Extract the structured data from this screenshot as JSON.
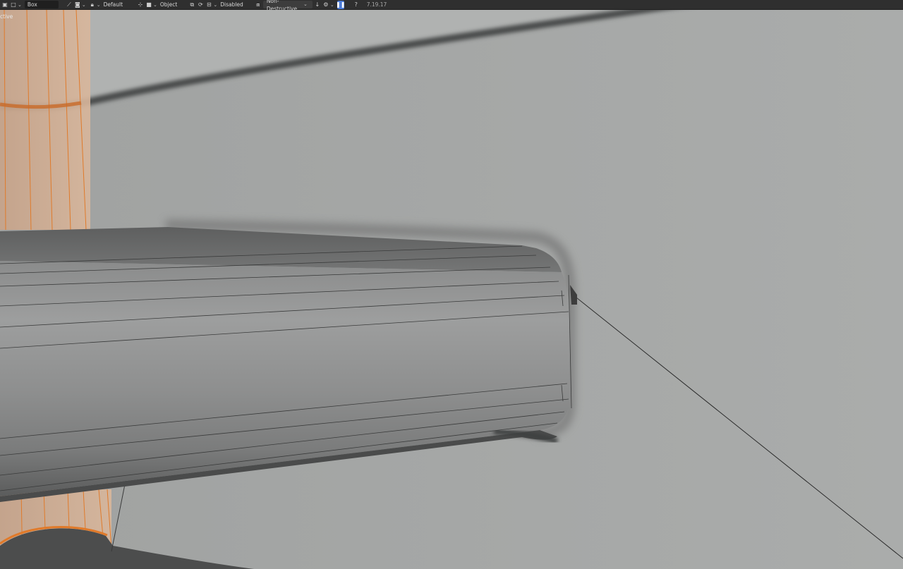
{
  "toolbar": {
    "tool_name": "Box",
    "orientation": "Default",
    "object_mode": "Object",
    "snapping": "Disabled",
    "boolean_mode": "Non-Destructive",
    "version": "7.19.17"
  },
  "viewport": {
    "status_text": "ctive"
  },
  "colors": {
    "toolbar_bg": "#2f2f2f",
    "viewport_bg": "#a7a9a8",
    "selection_orange": "#e07a2a",
    "accent_blue": "#4c7bd6"
  }
}
